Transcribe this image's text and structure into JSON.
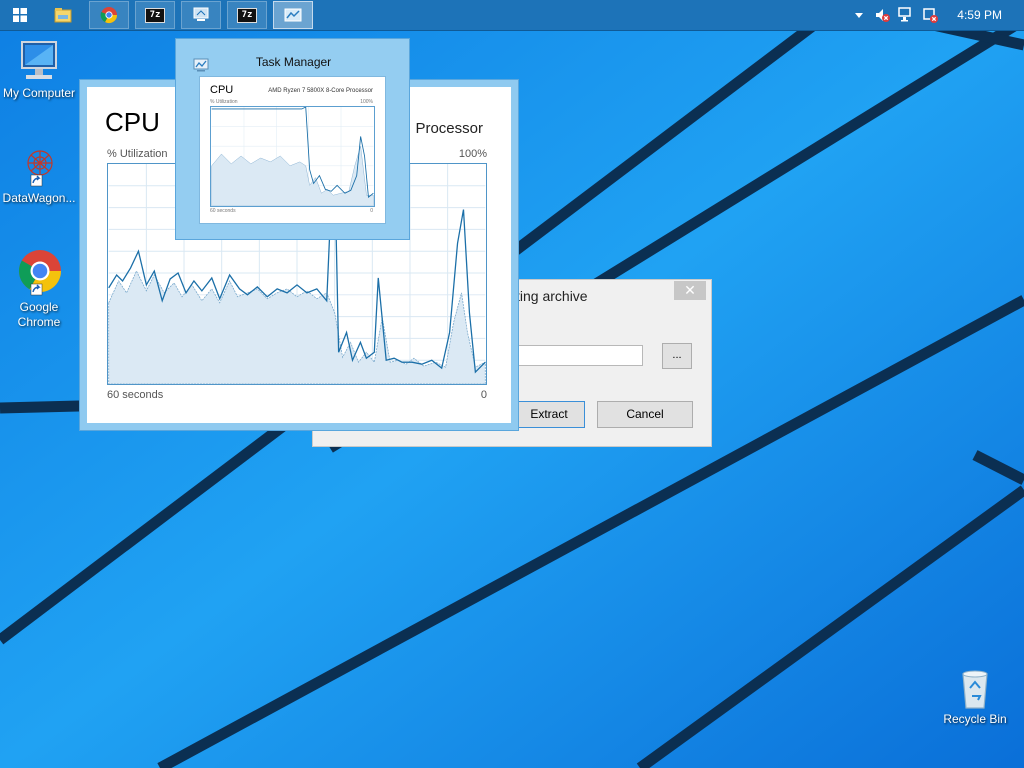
{
  "taskbar": {
    "start_icon": "windows-logo-icon",
    "clock": "4:59 PM",
    "apps": [
      {
        "name": "file-explorer-icon"
      },
      {
        "name": "chrome-icon"
      },
      {
        "label": "7z"
      },
      {
        "name": "network-app-icon"
      },
      {
        "label": "7z"
      },
      {
        "name": "task-manager-icon"
      }
    ],
    "tray": [
      "show-hidden-icons-icon",
      "volume-muted-icon",
      "network-disconnected-icon",
      "action-center-icon"
    ]
  },
  "desktop": {
    "icons": [
      {
        "label": "My Computer",
        "icon": "computer-icon"
      },
      {
        "label": "DataWagon...",
        "icon": "datawagon-icon"
      },
      {
        "label": "Google Chrome",
        "icon": "chrome-icon"
      },
      {
        "label": "Recycle Bin",
        "icon": "recycle-bin-icon"
      }
    ]
  },
  "task_manager": {
    "heading": "CPU",
    "processor_fragment": "Processor",
    "util_label": "% Utilization",
    "max_label": "100%",
    "time_label": "60 seconds",
    "min_label": "0"
  },
  "thumbnail": {
    "title": "Task Manager",
    "heading": "CPU",
    "processor": "AMD Ryzen 7 5800X 8-Core Processor",
    "util_label": "% Utilization",
    "max_label": "100%",
    "time_label": "60 seconds",
    "min_label": "0"
  },
  "dialog": {
    "title_fragment": "cting archive",
    "close_glyph": "✕",
    "path_value": "",
    "browse_label": "...",
    "extract_label": "Extract",
    "cancel_label": "Cancel"
  },
  "colors": {
    "taskbar": "#1d73b8",
    "wallpaper": "#1a8ef0",
    "graph_line": "#1b6fa8",
    "graph_fill": "#dbe9f4"
  }
}
